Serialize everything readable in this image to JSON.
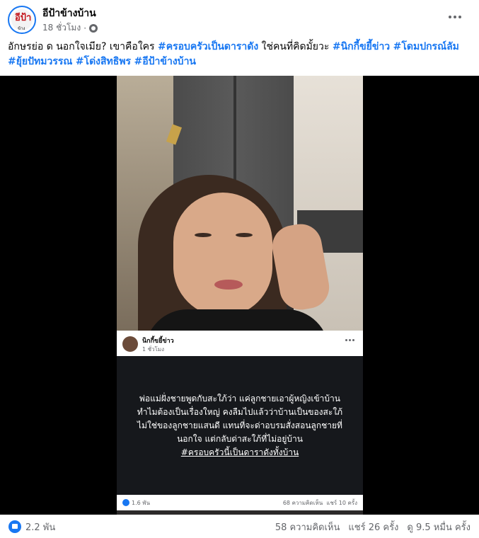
{
  "header": {
    "page_name": "อีป้าข้างบ้าน",
    "avatar_text": "อีป้า",
    "avatar_subtext": "ข้างบ้าน",
    "time": "18 ชั่วโมง",
    "separator": "·",
    "privacy_icon": "globe-icon",
    "more_icon": "more-dots-icon"
  },
  "caption": {
    "text_1": "อักษรย่อ ด นอกใจเมีย? เขาคือใคร ",
    "tag_1": "#ครอบครัวเป็นดาราดัง",
    "text_2": " ใช่คนที่คิดมั้ยวะ ",
    "tag_2": "#นิกกี้ขยี้ข่าว",
    "tag_3": "#โดมปกรณ์ลัม",
    "tag_4": "#ยุ้ยปัทมวรรณ",
    "tag_5": "#โด่งสิทธิพร",
    "tag_6": "#อีป้าข้างบ้าน"
  },
  "embedded_post": {
    "name": "นิกกี้ขยี้ข่าว",
    "time": "1 ชั่วโมง",
    "body_text": "พ่อแม่ฝั่งชายพูดกับสะใภ้ว่า แค่ลูกชายเอาผู้หญิงเข้าบ้านทำไมต้องเป็นเรื่องใหญ่ คงลืมไปแล้วว่าบ้านเป็นของสะใภ้ไม่ใช่ของลูกชายแสนดี แทนที่จะด่าอบรมสั่งสอนลูกชายที่นอกใจ แต่กลับด่าสะใภ้ที่ไม่อยู่บ้าน",
    "body_tag": "#ครอบครัวนี้เป็นดาราดังทั้งบ้าน",
    "likes": "1.6 พัน",
    "comments": "68 ความคิดเห็น",
    "shares": "แชร์ 10 ครั้ง"
  },
  "footer": {
    "reactions": "2.2 พัน",
    "comments": "58 ความคิดเห็น",
    "shares": "แชร์ 26 ครั้ง",
    "views": "ดู 9.5 หมื่น ครั้ง"
  },
  "colors": {
    "accent": "#1877f2",
    "text": "#050505",
    "secondary": "#65676b",
    "video_bg": "#000000"
  }
}
